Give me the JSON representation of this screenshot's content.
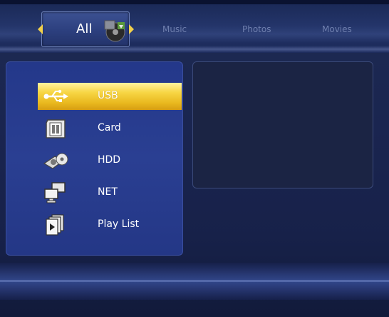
{
  "header": {
    "tabs": [
      {
        "label": "All",
        "selected": true
      },
      {
        "label": "Music",
        "selected": false
      },
      {
        "label": "Photos",
        "selected": false
      },
      {
        "label": "Movies",
        "selected": false
      }
    ]
  },
  "sources": {
    "selected_index": 0,
    "items": [
      {
        "label": "USB",
        "icon": "usb-icon"
      },
      {
        "label": "Card",
        "icon": "memory-card-icon"
      },
      {
        "label": "HDD",
        "icon": "hard-disk-icon"
      },
      {
        "label": "NET",
        "icon": "network-icon"
      },
      {
        "label": "Play List",
        "icon": "playlist-icon"
      }
    ]
  },
  "colors": {
    "background": "#1a2550",
    "panel": "#2a3f92",
    "highlight": "#f2c935",
    "tab_inactive_text": "#6f7fae"
  }
}
